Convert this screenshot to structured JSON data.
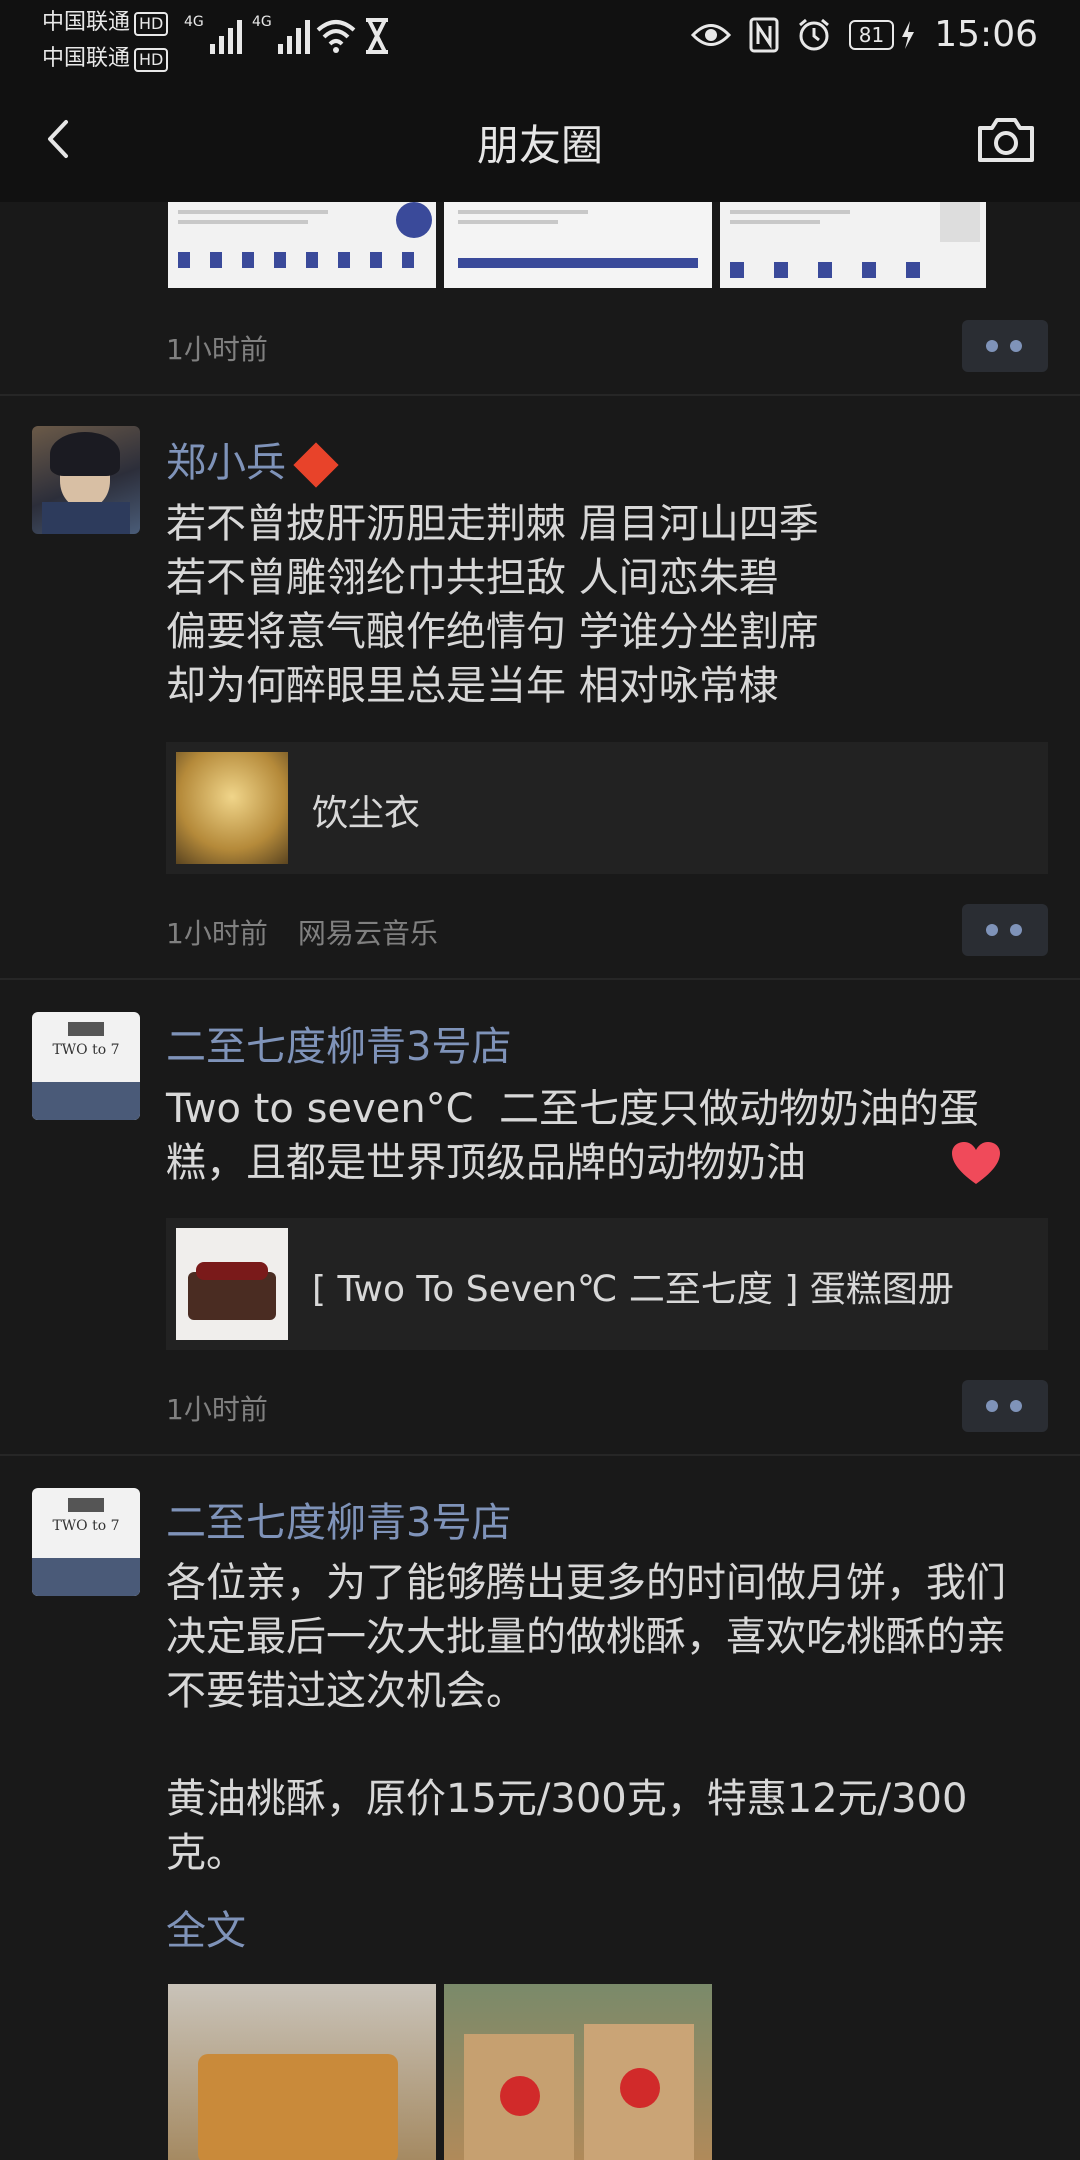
{
  "status": {
    "carrier1": "中国联通",
    "carrier2": "中国联通",
    "hd": "HD",
    "net1": "4G",
    "net2": "4G",
    "battery": "81",
    "time": "15:06",
    "icons": [
      "signal-icon",
      "wifi-icon",
      "hourglass-icon",
      "eye-icon",
      "nfc-icon",
      "alarm-icon",
      "battery-icon",
      "charging-icon"
    ]
  },
  "nav": {
    "title": "朋友圈",
    "back_icon": "back-arrow-icon",
    "camera_icon": "camera-icon"
  },
  "posts": [
    {
      "time": "1小时前"
    },
    {
      "name": "郑小兵",
      "text": "若不曾披肝沥胆走荆棘 眉目河山四季\n若不曾雕翎纶巾共担敌 人间恋朱碧\n偏要将意气酿作绝情句 学谁分坐割席\n却为何醉眼里总是当年 相对咏常棣",
      "card_title": "饮尘衣",
      "time": "1小时前",
      "source": "网易云音乐"
    },
    {
      "name": "二至七度柳青3号店",
      "text": "Two to seven°C  二至七度只做动物奶油的蛋糕，且都是世界顶级品牌的动物奶油",
      "card_title": "[ Two To Seven℃ 二至七度 ] 蛋糕图册",
      "time": "1小时前"
    },
    {
      "name": "二至七度柳青3号店",
      "text": "各位亲，为了能够腾出更多的时间做月饼，我们决定最后一次大批量的做桃酥，喜欢吃桃酥的亲不要错过这次机会。\n\n黄油桃酥，原价15元/300克，特惠12元/300克。",
      "full_text_link": "全文"
    }
  ],
  "colors": {
    "background": "#191919",
    "name_link": "#7f93b9",
    "meta": "#808080"
  }
}
